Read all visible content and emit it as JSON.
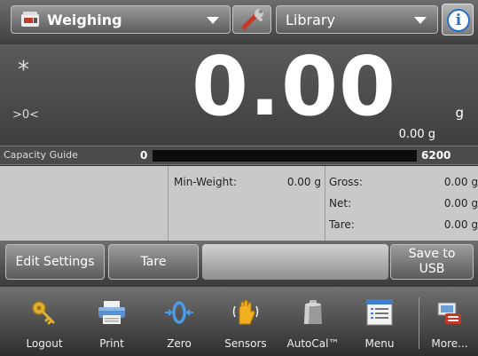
{
  "topbar": {
    "app_label": "Weighing",
    "library_label": "Library",
    "icons": {
      "app": "scale-icon",
      "tools": "wrench-icon",
      "info": "info-icon"
    }
  },
  "display": {
    "stable_indicator": "*",
    "zero_indicator": ">0<",
    "weight": "0.00",
    "unit": "g",
    "secondary_weight": "0.00 g"
  },
  "capacity_guide": {
    "label": "Capacity Guide",
    "min": "0",
    "max": "6200",
    "fill_fraction": 0.0
  },
  "info_panel": {
    "min_weight_label": "Min-Weight:",
    "min_weight_value": "0.00 g",
    "gross_label": "Gross:",
    "gross_value": "0.00 g",
    "net_label": "Net:",
    "net_value": "0.00 g",
    "tare_label": "Tare:",
    "tare_value": "0.00 g"
  },
  "actions": {
    "edit_settings": "Edit Settings",
    "tare": "Tare",
    "save_usb": "Save to USB"
  },
  "nav": [
    {
      "label": "Logout",
      "icon": "key-icon"
    },
    {
      "label": "Print",
      "icon": "printer-icon"
    },
    {
      "label": "Zero",
      "icon": "zero-icon"
    },
    {
      "label": "Sensors",
      "icon": "hand-sensor-icon"
    },
    {
      "label": "AutoCal™",
      "icon": "calibration-weight-icon"
    },
    {
      "label": "Menu",
      "icon": "menu-list-icon"
    },
    {
      "label": "More...",
      "icon": "more-apps-icon"
    }
  ],
  "colors": {
    "accent_blue": "#2b6fc2",
    "key_gold": "#e0b030"
  }
}
